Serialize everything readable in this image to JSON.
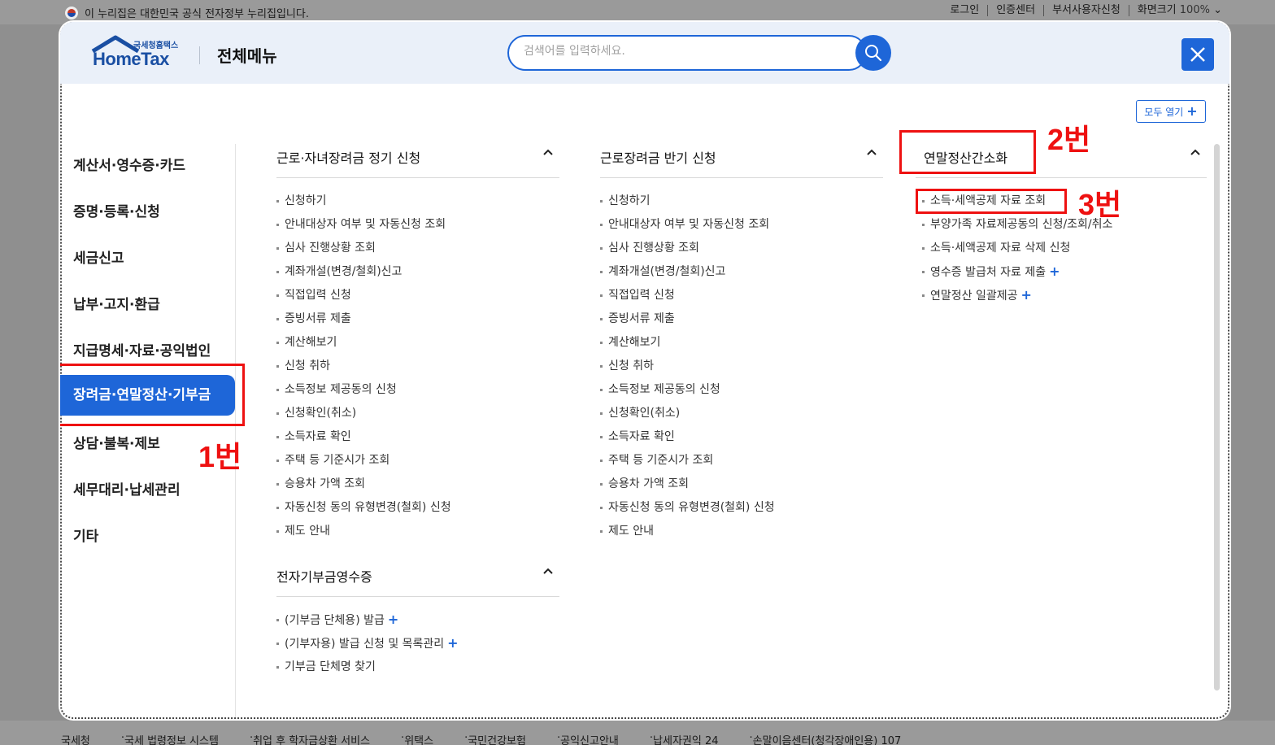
{
  "gov_bar": {
    "notice": "이 누리집은 대한민국 공식 전자정부 누리집입니다.",
    "links": [
      "로그인",
      "인증센터",
      "부서사용자신청",
      "화면크기"
    ],
    "zoom": "100%"
  },
  "header": {
    "logo_sub": "국세청홈택스",
    "logo_main": "HomeTax",
    "title": "전체메뉴",
    "search_placeholder": "검색어를 입력하세요.",
    "open_all": "모두 열기"
  },
  "left_nav": [
    "계산서·영수증·카드",
    "증명·등록·신청",
    "세금신고",
    "납부·고지·환급",
    "지급명세·자료·공익법인",
    "장려금·연말정산·기부금",
    "상담·불복·제보",
    "세무대리·납세관리",
    "기타"
  ],
  "columns": {
    "col1": {
      "title": "근로·자녀장려금 정기 신청",
      "items": [
        "신청하기",
        "안내대상자 여부 및 자동신청 조회",
        "심사 진행상황 조회",
        "계좌개설(변경/철회)신고",
        "직접입력 신청",
        "증빙서류 제출",
        "계산해보기",
        "신청 취하",
        "소득정보 제공동의 신청",
        "신청확인(취소)",
        "소득자료 확인",
        "주택 등 기준시가 조회",
        "승용차 가액 조회",
        "자동신청 동의 유형변경(철회) 신청",
        "제도 안내"
      ]
    },
    "col1b": {
      "title": "전자기부금영수증",
      "items": [
        "(기부금 단체용) 발급",
        "(기부자용) 발급 신청 및 목록관리",
        "기부금 단체명 찾기"
      ]
    },
    "col2": {
      "title": "근로장려금 반기 신청",
      "items": [
        "신청하기",
        "안내대상자 여부 및 자동신청 조회",
        "심사 진행상황 조회",
        "계좌개설(변경/철회)신고",
        "직접입력 신청",
        "증빙서류 제출",
        "계산해보기",
        "신청 취하",
        "소득정보 제공동의 신청",
        "신청확인(취소)",
        "소득자료 확인",
        "주택 등 기준시가 조회",
        "승용차 가액 조회",
        "자동신청 동의 유형변경(철회) 신청",
        "제도 안내"
      ]
    },
    "col3": {
      "title": "연말정산간소화",
      "items": [
        "소득·세액공제 자료 조회",
        "부양가족 자료제공동의 신청/조회/취소",
        "소득·세액공제 자료 삭제 신청",
        "영수증 발급처 자료 제출",
        "연말정산 일괄제공"
      ]
    }
  },
  "annotations": {
    "label1": "1번",
    "label2": "2번",
    "label3": "3번",
    "color": "#ee1111"
  },
  "footer_links": [
    "국세청",
    "국세 법령정보 시스템",
    "취업 후 학자금상환 서비스",
    "위택스",
    "국민건강보험",
    "공익신고안내",
    "납세자권익 24",
    "손말이음센터(청각장애인용) 107"
  ],
  "colors": {
    "accent": "#1e66d8",
    "header_bg": "#eaf0f9"
  }
}
